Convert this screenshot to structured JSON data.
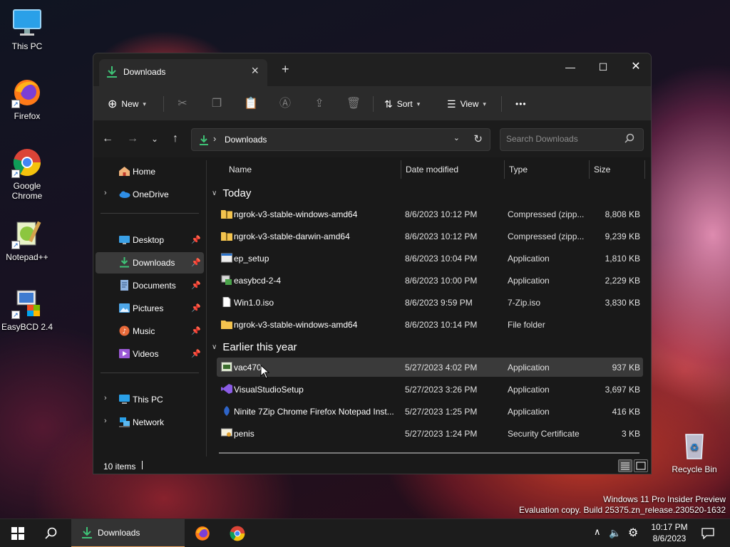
{
  "desktop": {
    "icons": [
      {
        "label": "This PC",
        "icon": "monitor-icon"
      },
      {
        "label": "Firefox",
        "icon": "firefox-icon"
      },
      {
        "label": "Google Chrome",
        "icon": "chrome-icon"
      },
      {
        "label": "Notepad++",
        "icon": "notepad-plus-plus-icon"
      },
      {
        "label": "EasyBCD 2.4",
        "icon": "easybcd-icon"
      },
      {
        "label": "Recycle Bin",
        "icon": "recycle-bin-icon"
      }
    ]
  },
  "window": {
    "tab_title": "Downloads",
    "toolbar": {
      "new_label": "New",
      "sort_label": "Sort",
      "view_label": "View",
      "more_label": "•••"
    },
    "address": {
      "path": "Downloads",
      "separator": "›"
    },
    "search": {
      "placeholder": "Search Downloads"
    },
    "sidebar": {
      "items": [
        {
          "label": "Home",
          "icon": "home-icon"
        },
        {
          "label": "OneDrive",
          "icon": "cloud-icon"
        },
        {
          "label": "Desktop",
          "icon": "desktop-icon"
        },
        {
          "label": "Downloads",
          "icon": "download-icon"
        },
        {
          "label": "Documents",
          "icon": "document-icon"
        },
        {
          "label": "Pictures",
          "icon": "picture-icon"
        },
        {
          "label": "Music",
          "icon": "music-icon"
        },
        {
          "label": "Videos",
          "icon": "video-icon"
        },
        {
          "label": "This PC",
          "icon": "monitor-icon"
        },
        {
          "label": "Network",
          "icon": "network-icon"
        }
      ]
    },
    "columns": {
      "name": "Name",
      "date": "Date modified",
      "type": "Type",
      "size": "Size"
    },
    "groups": [
      {
        "title": "Today",
        "files": [
          {
            "name": "ngrok-v3-stable-windows-amd64",
            "date": "8/6/2023 10:12 PM",
            "type": "Compressed (zipp...",
            "size": "8,808 KB",
            "icon": "zip-folder-icon"
          },
          {
            "name": "ngrok-v3-stable-darwin-amd64",
            "date": "8/6/2023 10:12 PM",
            "type": "Compressed (zipp...",
            "size": "9,239 KB",
            "icon": "zip-folder-icon"
          },
          {
            "name": "ep_setup",
            "date": "8/6/2023 10:04 PM",
            "type": "Application",
            "size": "1,810 KB",
            "icon": "application-icon"
          },
          {
            "name": "easybcd-2-4",
            "date": "8/6/2023 10:00 PM",
            "type": "Application",
            "size": "2,229 KB",
            "icon": "installer-icon"
          },
          {
            "name": "Win1.0.iso",
            "date": "8/6/2023 9:59 PM",
            "type": "7-Zip.iso",
            "size": "3,830 KB",
            "icon": "file-icon"
          },
          {
            "name": "ngrok-v3-stable-windows-amd64",
            "date": "8/6/2023 10:14 PM",
            "type": "File folder",
            "size": "",
            "icon": "folder-icon"
          }
        ]
      },
      {
        "title": "Earlier this year",
        "files": [
          {
            "name": "vac470",
            "date": "5/27/2023 4:02 PM",
            "type": "Application",
            "size": "937 KB",
            "icon": "vac-app-icon"
          },
          {
            "name": "VisualStudioSetup",
            "date": "5/27/2023 3:26 PM",
            "type": "Application",
            "size": "3,697 KB",
            "icon": "visual-studio-icon"
          },
          {
            "name": "Ninite 7Zip Chrome Firefox Notepad Inst...",
            "date": "5/27/2023 1:25 PM",
            "type": "Application",
            "size": "416 KB",
            "icon": "ninite-icon"
          },
          {
            "name": "penis",
            "date": "5/27/2023 1:24 PM",
            "type": "Security Certificate",
            "size": "3 KB",
            "icon": "certificate-icon"
          }
        ]
      }
    ],
    "status": {
      "item_count": "10 items"
    }
  },
  "watermark": {
    "line1": "Windows 11 Pro Insider Preview",
    "line2": "Evaluation copy. Build 25375.zn_release.230520-1632"
  },
  "taskbar": {
    "active_app_label": "Downloads",
    "clock_time": "10:17 PM",
    "clock_date": "8/6/2023"
  },
  "colors": {
    "download_accent": "#3ec276",
    "folder_yellow": "#f4c44e",
    "taskbar_active": "#e6a05b"
  }
}
